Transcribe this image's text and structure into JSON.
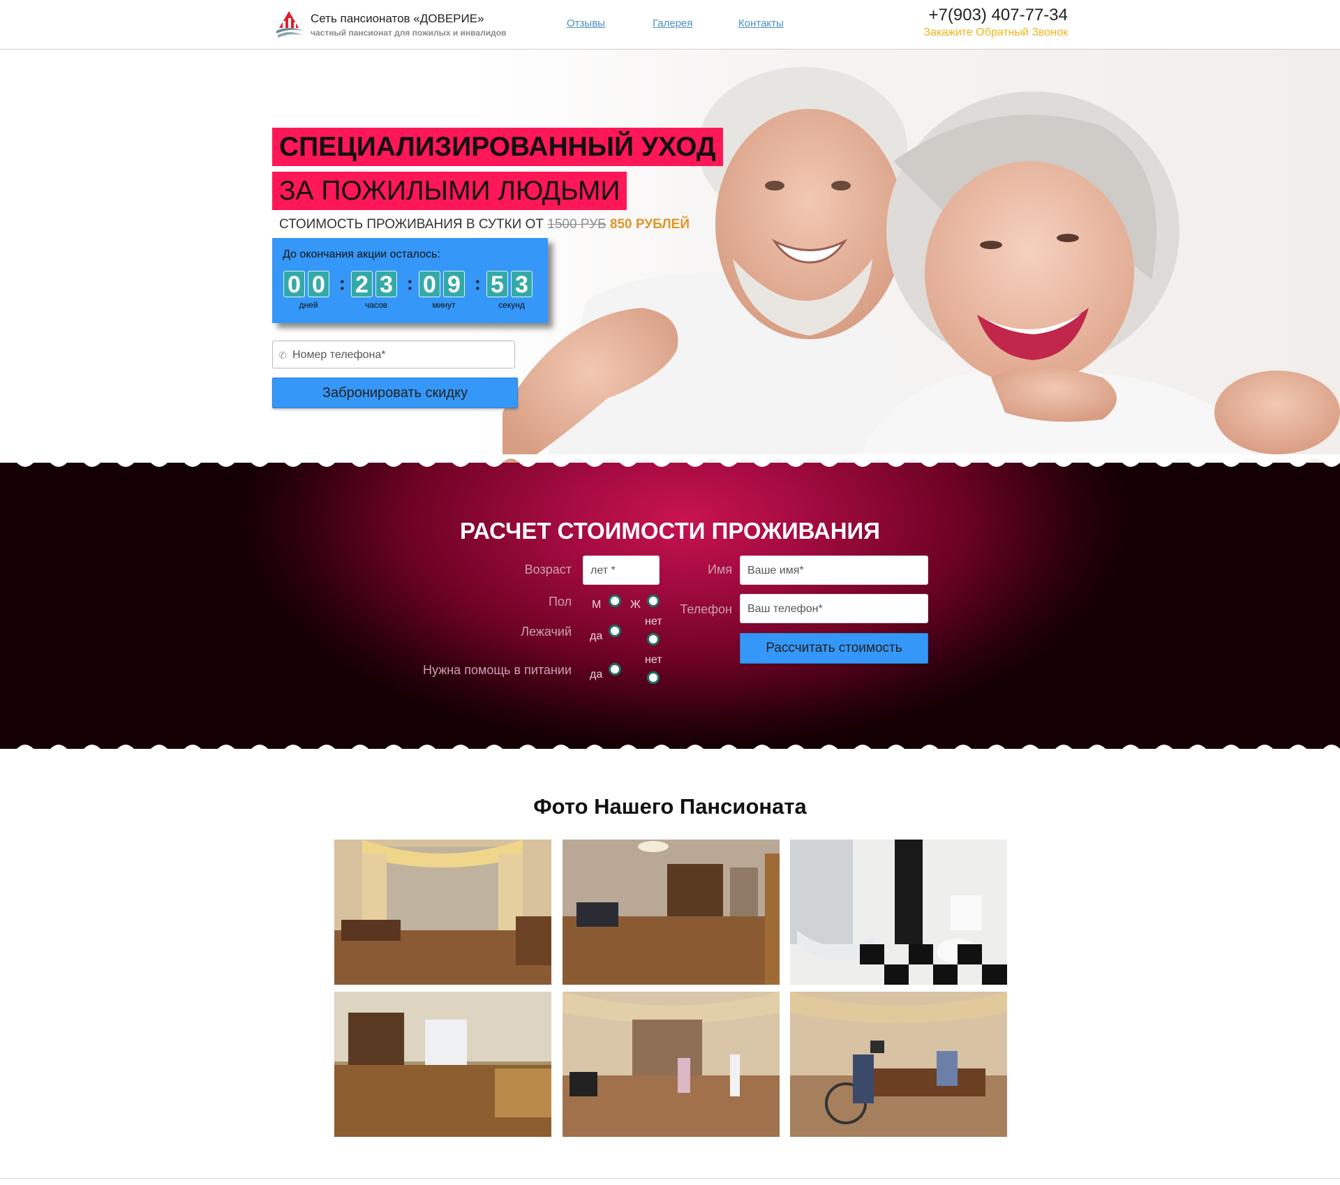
{
  "header": {
    "brand_title": "Сеть пансионатов «ДОВЕРИЕ»",
    "brand_subtitle": "частный пансионат для пожилых и инвалидов",
    "nav": [
      "Отзывы",
      "Галерея",
      "Контакты"
    ],
    "phone": "+7(903) 407-77-34",
    "callback": "Закажите Обратный Звонок"
  },
  "hero": {
    "heading_line1": "СПЕЦИАЛИЗИРОВАННЫЙ УХОД",
    "heading_line2": "ЗА ПОЖИЛЫМИ ЛЮДЬМИ",
    "price_prefix": "СТОИМОСТЬ ПРОЖИВАНИЯ В СУТКИ ОТ",
    "price_old": "1500 РУБ",
    "price_new": "850 РУБЛЕЙ",
    "timer": {
      "title": "До окончания акции осталось:",
      "days": [
        "0",
        "0"
      ],
      "hours": [
        "2",
        "3"
      ],
      "minutes": [
        "0",
        "9"
      ],
      "seconds": [
        "5",
        "3"
      ],
      "labels": [
        "дней",
        "часов",
        "минут",
        "секунд"
      ]
    },
    "phone_placeholder": "Номер телефона*",
    "book_button": "Забронировать скидку"
  },
  "calc": {
    "title": "РАСЧЕТ СТОИМОСТИ ПРОЖИВАНИЯ",
    "age_label": "Возраст",
    "age_placeholder": "лет *",
    "sex_label": "Пол",
    "sex_m": "М",
    "sex_f": "Ж",
    "bedridden_label": "Лежачий",
    "feeding_label": "Нужна помощь в питании",
    "yes": "да",
    "no": "нет",
    "name_label": "Имя",
    "name_placeholder": "Ваше имя*",
    "phone_label": "Телефон",
    "phone_placeholder": "Ваш телефон*",
    "button": "Рассчитать стоимость"
  },
  "gallery": {
    "title": "Фото Нашего Пансионата"
  },
  "colors": {
    "accent_pink": "#ff1757",
    "accent_blue": "#3597f7",
    "accent_yellow": "#f2b418",
    "price_orange": "#e0962a",
    "timer_digit": "#34aaa8",
    "calc_bg": "#a30b40"
  }
}
